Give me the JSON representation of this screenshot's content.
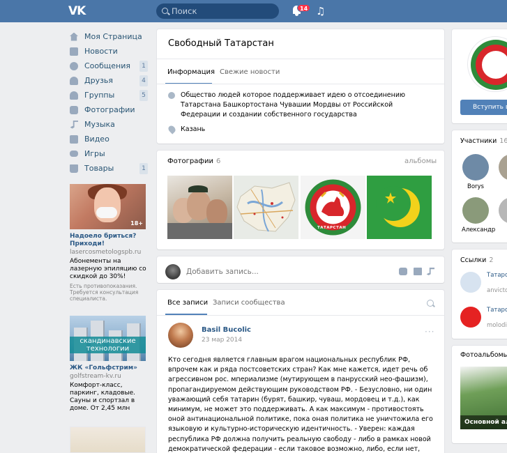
{
  "header": {
    "logo": "VK",
    "search_placeholder": "Поиск",
    "notifications_count": "14"
  },
  "nav": [
    {
      "label": "Моя Страница",
      "count": "",
      "icon": "home-icon",
      "cls": "ic-home"
    },
    {
      "label": "Новости",
      "count": "",
      "icon": "news-icon",
      "cls": "ic-news"
    },
    {
      "label": "Сообщения",
      "count": "1",
      "icon": "messages-icon",
      "cls": "ic-msg"
    },
    {
      "label": "Друзья",
      "count": "4",
      "icon": "friends-icon",
      "cls": "ic-friends"
    },
    {
      "label": "Группы",
      "count": "5",
      "icon": "groups-icon",
      "cls": "ic-group"
    },
    {
      "label": "Фотографии",
      "count": "",
      "icon": "camera-icon",
      "cls": "ic-photo"
    },
    {
      "label": "Музыка",
      "count": "",
      "icon": "music-icon",
      "cls": "ic-music"
    },
    {
      "label": "Видео",
      "count": "",
      "icon": "video-icon",
      "cls": "ic-video"
    },
    {
      "label": "Игры",
      "count": "",
      "icon": "gamepad-icon",
      "cls": "ic-game"
    },
    {
      "label": "Товары",
      "count": "1",
      "icon": "bag-icon",
      "cls": "ic-shop"
    }
  ],
  "ads": {
    "ad1": {
      "badge": "18+",
      "title": "Надоело бриться? Приходи!",
      "domain": "lasercosmetologspb.ru",
      "text": "Абонементы на лазерную эпиляцию со скидкой до 30%!",
      "small": "Есть противопоказания. Требуется консультация специалиста."
    },
    "ad2": {
      "banner": "скандинавские технологии",
      "title": "ЖК «Гольфстрим»",
      "domain": "golfstream-kv.ru",
      "text": "Комфорт-класс, паркинг, кладовые. Сауны и спортзал в доме. От 2,45 млн"
    }
  },
  "group": {
    "title": "Свободный Татарстан",
    "tabs": [
      "Информация",
      "Свежие новости"
    ],
    "description": "Общество людей которое поддерживает идею о отсоединению Татарстана Башкортостана Чувашии Мордвы от Российской Федерации и создании собственного государства",
    "city": "Казань"
  },
  "photos": {
    "label": "Фотографии",
    "count": "6",
    "link": "альбомы",
    "emblem_text": "ТАТАРСТАН"
  },
  "composer": {
    "placeholder": "Добавить запись..."
  },
  "wall": {
    "tabs": [
      "Все записи",
      "Записи сообщества"
    ],
    "post": {
      "author": "Basil Bucolic",
      "date": "23 мар 2014",
      "more": "···",
      "text": "Кто сегодня является главным врагом национальных республик РФ, впрочем как и ряда постсоветских стран? Как мне кажется, идет речь об агрессивном рос. мпериализме (мутирующем в панрусский нео-фашизм), пропагандируемом действующим руководством РФ. - Безусловно, ни один уважающий себя татарин (бурят, башкир, чуваш, мордовец и т.д.), как минимум, не может это поддерживать. А как максимум - противостоять оной антинациональной политике, пока оная политика не уничтожила его языковую и культурно-историческую идентичность. - Уверен: каждая республика РФ должна получить реальную свободу - либо в рамках новой демократической федерации - если таковое возможно, либо, если нет, как независимое государство! Иначе"
    }
  },
  "right": {
    "join_label": "Вступить в",
    "members": {
      "label": "Участники",
      "count": "16",
      "items": [
        {
          "name": "Borys",
          "color": "#6e8aa6"
        },
        {
          "name": "Н",
          "color": "#a9a191"
        },
        {
          "name": "Александр",
          "color": "#8a9a7a"
        },
        {
          "name": "Ес",
          "color": "#b7b7b7"
        }
      ]
    },
    "links": {
      "label": "Ссылки",
      "count": "2",
      "items": [
        {
          "name": "Татарс свобод",
          "domain": "anvicto",
          "color": "#d7e3f0"
        },
        {
          "name": "Татарс свобод",
          "domain": "molodi",
          "color": "#e52222"
        }
      ]
    },
    "albums": {
      "label": "Фотоальбомы",
      "caption": "Основной аль"
    }
  }
}
